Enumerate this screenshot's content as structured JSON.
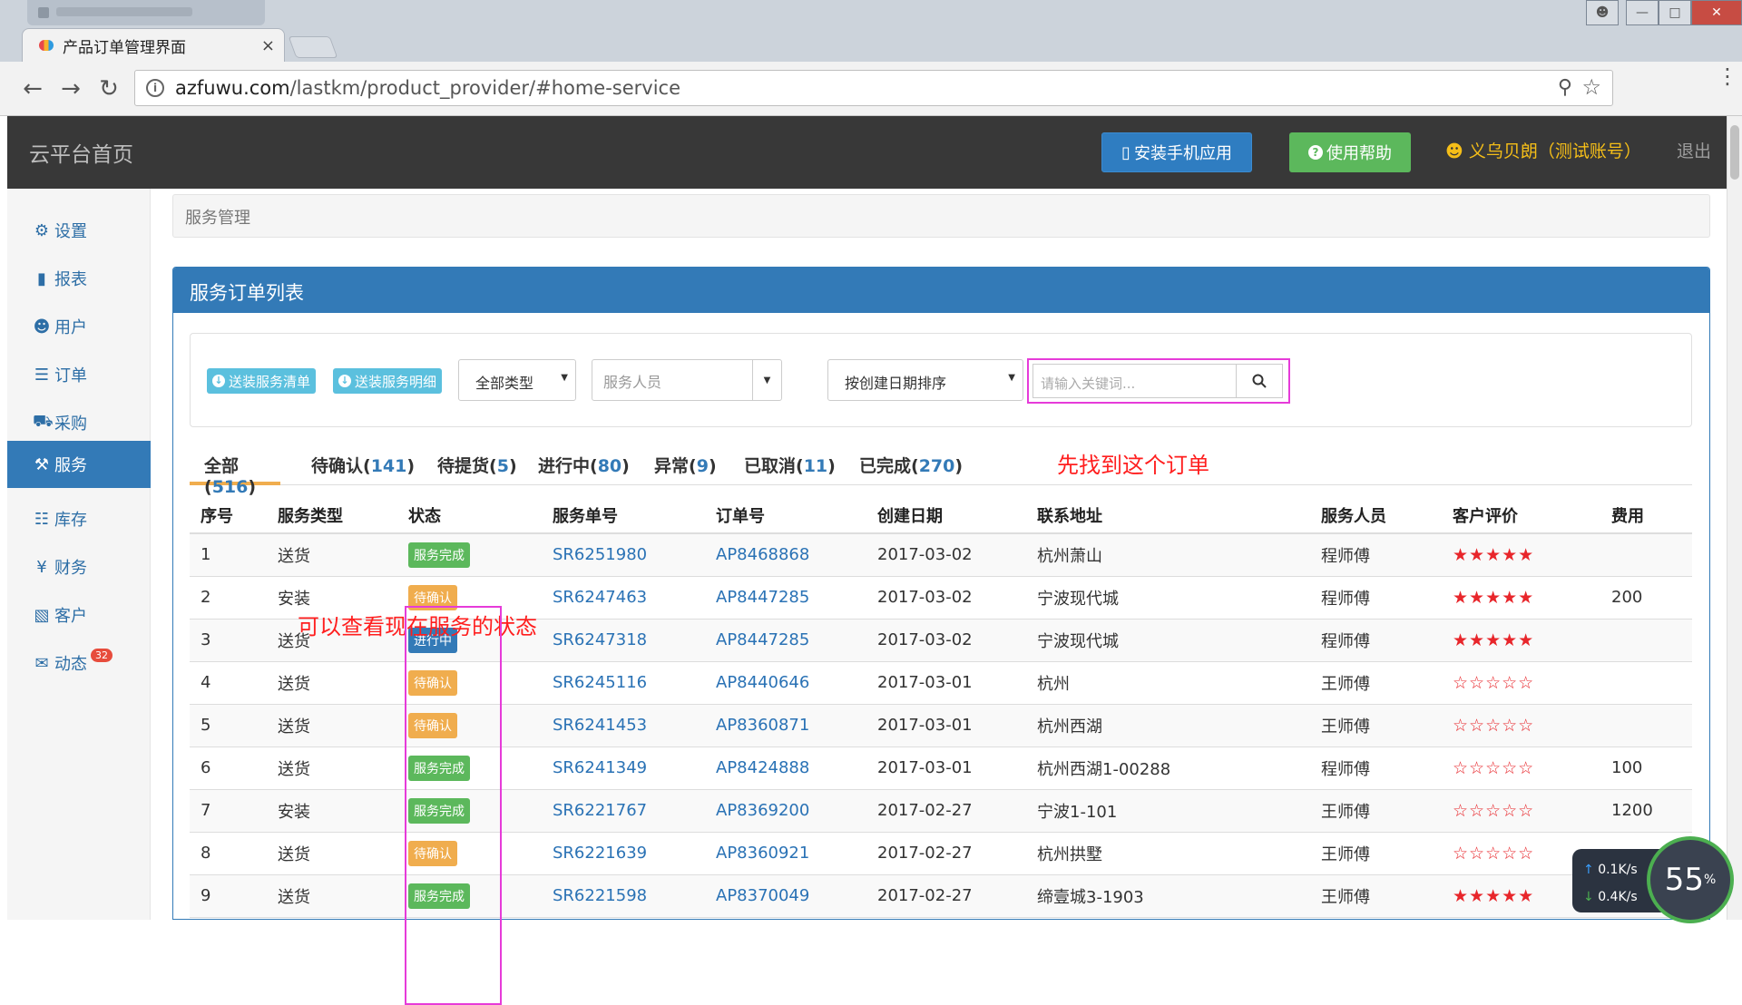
{
  "browser": {
    "tab_title": "产品订单管理界面",
    "tab_close": "×",
    "url_host": "azfuwu.com",
    "url_path": "/lastkm/product_provider/#home-service"
  },
  "topnav": {
    "brand": "云平台首页",
    "install_app": "安装手机应用",
    "help": "使用帮助",
    "user": "义乌贝朗（测试账号）",
    "logout": "退出"
  },
  "sidebar": {
    "items": [
      {
        "label": "设置",
        "icon": "gear-icon"
      },
      {
        "label": "报表",
        "icon": "bar-chart-icon"
      },
      {
        "label": "用户",
        "icon": "user-icon"
      },
      {
        "label": "订单",
        "icon": "list-icon"
      },
      {
        "label": "采购",
        "icon": "cart-icon"
      },
      {
        "label": "服务",
        "icon": "wrench-icon"
      },
      {
        "label": "库存",
        "icon": "barcode-icon"
      },
      {
        "label": "财务",
        "icon": "yen-icon"
      },
      {
        "label": "客户",
        "icon": "briefcase-icon"
      },
      {
        "label": "动态",
        "icon": "comment-icon",
        "badge": "32"
      }
    ]
  },
  "breadcrumb": "服务管理",
  "panel": {
    "title": "服务订单列表",
    "btn_delivery_list": "送装服务清单",
    "btn_delivery_detail": "送装服务明细",
    "type_select": "全部类型",
    "staff_placeholder": "服务人员",
    "sort_select": "按创建日期排序",
    "keyword_placeholder": "请输入关键词..."
  },
  "filter_tabs": [
    {
      "label": "全部",
      "count": "516"
    },
    {
      "label": "待确认",
      "count": "141"
    },
    {
      "label": "待提货",
      "count": "5"
    },
    {
      "label": "进行中",
      "count": "80"
    },
    {
      "label": "异常",
      "count": "9"
    },
    {
      "label": "已取消",
      "count": "11"
    },
    {
      "label": "已完成",
      "count": "270"
    }
  ],
  "annotations": {
    "find_order": "先找到这个订单",
    "view_status": "可以查看现在服务的状态"
  },
  "table": {
    "headers": [
      "序号",
      "服务类型",
      "状态",
      "服务单号",
      "订单号",
      "创建日期",
      "联系地址",
      "服务人员",
      "客户评价",
      "费用"
    ],
    "rows": [
      {
        "no": "1",
        "type": "送货",
        "status": "服务完成",
        "status_color": "#5cb85c",
        "sr": "SR6251980",
        "ap": "AP8468868",
        "date": "2017-03-02",
        "addr": "杭州萧山",
        "staff": "程师傅",
        "rating": "★★★★★",
        "fee": ""
      },
      {
        "no": "2",
        "type": "安装",
        "status": "待确认",
        "status_color": "#f0ad4e",
        "sr": "SR6247463",
        "ap": "AP8447285",
        "date": "2017-03-02",
        "addr": "宁波现代城",
        "staff": "程师傅",
        "rating": "★★★★★",
        "fee": "200"
      },
      {
        "no": "3",
        "type": "送货",
        "status": "进行中",
        "status_color": "#337ab7",
        "sr": "SR6247318",
        "ap": "AP8447285",
        "date": "2017-03-02",
        "addr": "宁波现代城",
        "staff": "程师傅",
        "rating": "★★★★★",
        "fee": ""
      },
      {
        "no": "4",
        "type": "送货",
        "status": "待确认",
        "status_color": "#f0ad4e",
        "sr": "SR6245116",
        "ap": "AP8440646",
        "date": "2017-03-01",
        "addr": "杭州",
        "staff": "王师傅",
        "rating": "☆☆☆☆☆",
        "fee": ""
      },
      {
        "no": "5",
        "type": "送货",
        "status": "待确认",
        "status_color": "#f0ad4e",
        "sr": "SR6241453",
        "ap": "AP8360871",
        "date": "2017-03-01",
        "addr": "杭州西湖",
        "staff": "王师傅",
        "rating": "☆☆☆☆☆",
        "fee": ""
      },
      {
        "no": "6",
        "type": "送货",
        "status": "服务完成",
        "status_color": "#5cb85c",
        "sr": "SR6241349",
        "ap": "AP8424888",
        "date": "2017-03-01",
        "addr": "杭州西湖1-00288",
        "staff": "程师傅",
        "rating": "☆☆☆☆☆",
        "fee": "100"
      },
      {
        "no": "7",
        "type": "安装",
        "status": "服务完成",
        "status_color": "#5cb85c",
        "sr": "SR6221767",
        "ap": "AP8369200",
        "date": "2017-02-27",
        "addr": "宁波1-101",
        "staff": "王师傅",
        "rating": "☆☆☆☆☆",
        "fee": "1200"
      },
      {
        "no": "8",
        "type": "送货",
        "status": "待确认",
        "status_color": "#f0ad4e",
        "sr": "SR6221639",
        "ap": "AP8360921",
        "date": "2017-02-27",
        "addr": "杭州拱墅",
        "staff": "王师傅",
        "rating": "☆☆☆☆☆",
        "fee": ""
      },
      {
        "no": "9",
        "type": "送货",
        "status": "服务完成",
        "status_color": "#5cb85c",
        "sr": "SR6221598",
        "ap": "AP8370049",
        "date": "2017-02-27",
        "addr": "缔壹城3-1903",
        "staff": "王师傅",
        "rating": "★★★★★",
        "fee": ""
      }
    ]
  },
  "speed_widget": {
    "up": "0.1K/s",
    "down": "0.4K/s",
    "percent": "55",
    "percent_unit": "%"
  }
}
